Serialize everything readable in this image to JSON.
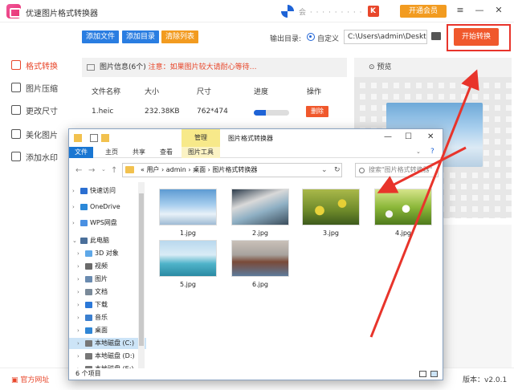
{
  "app": {
    "title": "优速图片格式转换器",
    "vip_label": "开通会员",
    "status_dots": "会 · · · · · · · · ·"
  },
  "window_buttons": {
    "menu": "≡",
    "minimize": "—",
    "maximize": "⛶",
    "close": "✕"
  },
  "sidebar": {
    "items": [
      {
        "label": "格式转换",
        "icon": "convert-icon",
        "active": true
      },
      {
        "label": "图片压缩",
        "icon": "compress-icon",
        "active": false
      },
      {
        "label": "更改尺寸",
        "icon": "resize-icon",
        "active": false
      },
      {
        "label": "美化图片",
        "icon": "beautify-icon",
        "active": false
      },
      {
        "label": "添加水印",
        "icon": "watermark-icon",
        "active": false
      }
    ]
  },
  "toolbar": {
    "add_file": "添加文件",
    "add_dir": "添加目录",
    "clear_list": "清除列表",
    "output_label": "输出目录:",
    "custom_label": "自定义",
    "output_path": "C:\\Users\\admin\\Deskto",
    "start_label": "开始转换"
  },
  "file_panel": {
    "info_title": "图片信息(6个)",
    "warning": "注意：如果图片较大请耐心等待…",
    "columns": [
      "文件名称",
      "大小",
      "尺寸",
      "进度",
      "操作"
    ],
    "rows": [
      {
        "name": "1.heic",
        "size": "232.38KB",
        "dimensions": "762*474",
        "progress": 0.35,
        "action": "删除"
      }
    ]
  },
  "preview": {
    "title": "预览"
  },
  "bottom": {
    "site_link": "官方网址",
    "version": "版本：v2.0.1"
  },
  "explorer": {
    "title": "图片格式转换器",
    "manage_tab": "管理",
    "ribbon_tabs": [
      "文件",
      "主页",
      "共享",
      "查看",
      "图片工具"
    ],
    "address": "«  用户  ›  admin  ›  桌面  ›  图片格式转换器",
    "search_placeholder": "搜索\"图片格式转换器\"",
    "nav": [
      {
        "label": "快速访问",
        "icon": "star-icon",
        "color": "#2b6fd1",
        "selected": false
      },
      {
        "label": "OneDrive",
        "icon": "cloud-icon",
        "color": "#2b88d8",
        "selected": false
      },
      {
        "label": "WPS网盘",
        "icon": "cloud-icon",
        "color": "#4a90e2",
        "selected": false
      },
      {
        "label": "此电脑",
        "icon": "computer-icon",
        "color": "#4a6f9a",
        "selected": false
      },
      {
        "label": "3D 对象",
        "icon": "cube-icon",
        "color": "#5fa8e8",
        "selected": false
      },
      {
        "label": "视频",
        "icon": "video-icon",
        "color": "#6a6a6a",
        "selected": false
      },
      {
        "label": "图片",
        "icon": "picture-icon",
        "color": "#6a8bb0",
        "selected": false
      },
      {
        "label": "文档",
        "icon": "document-icon",
        "color": "#7a8a99",
        "selected": false
      },
      {
        "label": "下载",
        "icon": "download-icon",
        "color": "#2b78d8",
        "selected": false
      },
      {
        "label": "音乐",
        "icon": "music-icon",
        "color": "#3b7fcf",
        "selected": false
      },
      {
        "label": "桌面",
        "icon": "desktop-icon",
        "color": "#2f86d6",
        "selected": false
      },
      {
        "label": "本地磁盘 (C:)",
        "icon": "disk-icon",
        "color": "#777777",
        "selected": true
      },
      {
        "label": "本地磁盘 (D:)",
        "icon": "disk-icon",
        "color": "#777777",
        "selected": false
      },
      {
        "label": "本地磁盘 (E:)",
        "icon": "disk-icon",
        "color": "#777777",
        "selected": false
      }
    ],
    "files": [
      {
        "name": "1.jpg",
        "theme": "sky"
      },
      {
        "name": "2.jpg",
        "theme": "desk"
      },
      {
        "name": "3.jpg",
        "theme": "flowers"
      },
      {
        "name": "4.jpg",
        "theme": "daisies"
      },
      {
        "name": "5.jpg",
        "theme": "pier"
      },
      {
        "name": "6.jpg",
        "theme": "lake"
      }
    ],
    "status": "6 个项目"
  },
  "colors": {
    "accent": "#e8472b",
    "blue": "#1e63d6",
    "orange": "#f29b20",
    "start": "#f0582c"
  }
}
